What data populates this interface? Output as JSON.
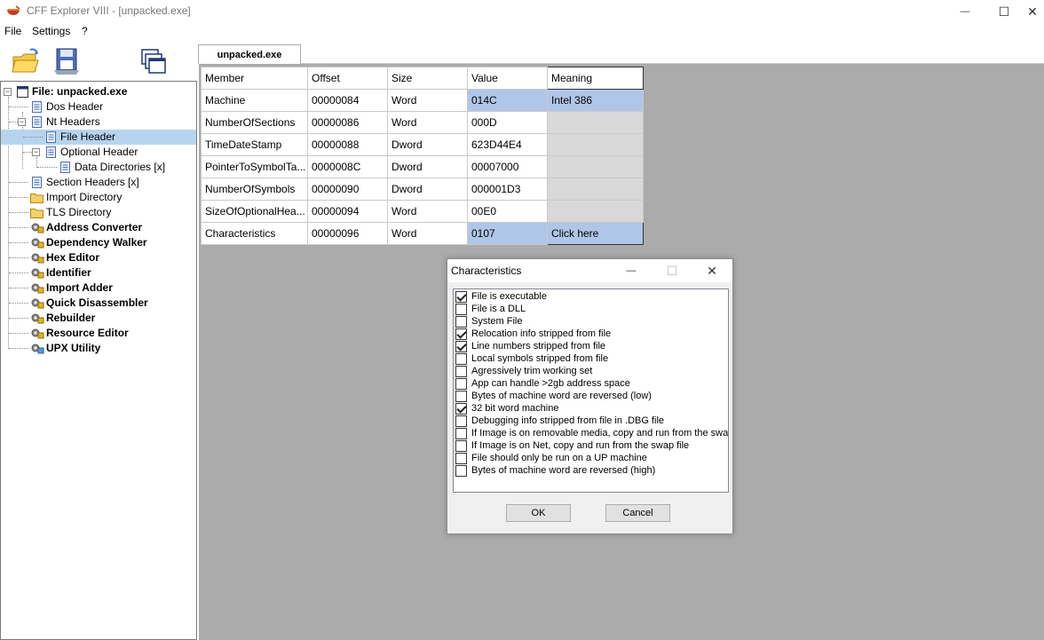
{
  "window": {
    "title": "CFF Explorer VIII - [unpacked.exe]",
    "minimize": "—",
    "maximize": "☐",
    "close": "✕"
  },
  "menu": [
    "File",
    "Settings",
    "?"
  ],
  "toolbar": {
    "icons": [
      "open-folder-icon",
      "save-disk-icon",
      "windows-icon"
    ]
  },
  "tree": {
    "root": "File: unpacked.exe",
    "items": [
      {
        "label": "Dos Header",
        "icon": "header-icon"
      },
      {
        "label": "Nt Headers",
        "icon": "header-icon"
      },
      {
        "label": "File Header",
        "icon": "header-icon",
        "selected": true
      },
      {
        "label": "Optional Header",
        "icon": "header-icon"
      },
      {
        "label": "Data Directories [x]",
        "icon": "header-icon"
      },
      {
        "label": "Section Headers [x]",
        "icon": "header-icon"
      },
      {
        "label": "Import Directory",
        "icon": "folder-icon"
      },
      {
        "label": "TLS Directory",
        "icon": "folder-icon"
      },
      {
        "label": "Address Converter",
        "icon": "tool-icon"
      },
      {
        "label": "Dependency Walker",
        "icon": "tool-icon"
      },
      {
        "label": "Hex Editor",
        "icon": "tool-icon"
      },
      {
        "label": "Identifier",
        "icon": "tool-icon"
      },
      {
        "label": "Import Adder",
        "icon": "tool-icon"
      },
      {
        "label": "Quick Disassembler",
        "icon": "tool-icon"
      },
      {
        "label": "Rebuilder",
        "icon": "tool-icon"
      },
      {
        "label": "Resource Editor",
        "icon": "tool-icon"
      },
      {
        "label": "UPX Utility",
        "icon": "tool-icon"
      }
    ]
  },
  "tab": {
    "label": "unpacked.exe"
  },
  "table": {
    "headers": [
      "Member",
      "Offset",
      "Size",
      "Value",
      "Meaning"
    ],
    "rows": [
      [
        "Machine",
        "00000084",
        "Word",
        "014C",
        "Intel 386"
      ],
      [
        "NumberOfSections",
        "00000086",
        "Word",
        "000D",
        ""
      ],
      [
        "TimeDateStamp",
        "00000088",
        "Dword",
        "623D44E4",
        ""
      ],
      [
        "PointerToSymbolTa...",
        "0000008C",
        "Dword",
        "00007000",
        ""
      ],
      [
        "NumberOfSymbols",
        "00000090",
        "Dword",
        "000001D3",
        ""
      ],
      [
        "SizeOfOptionalHea...",
        "00000094",
        "Word",
        "00E0",
        ""
      ],
      [
        "Characteristics",
        "00000096",
        "Word",
        "0107",
        "Click here"
      ]
    ]
  },
  "dialog": {
    "title": "Characteristics",
    "minimize": "—",
    "maximize": "☐",
    "close": "✕",
    "options": [
      {
        "label": "File is executable",
        "checked": true
      },
      {
        "label": "File is a DLL",
        "checked": false
      },
      {
        "label": "System File",
        "checked": false
      },
      {
        "label": "Relocation info stripped from file",
        "checked": true
      },
      {
        "label": "Line numbers stripped from file",
        "checked": true
      },
      {
        "label": "Local symbols stripped from file",
        "checked": false
      },
      {
        "label": "Agressively trim working set",
        "checked": false
      },
      {
        "label": "App can handle >2gb address space",
        "checked": false
      },
      {
        "label": "Bytes of machine word are reversed (low)",
        "checked": false
      },
      {
        "label": "32 bit word machine",
        "checked": true
      },
      {
        "label": "Debugging info stripped from file in .DBG file",
        "checked": false
      },
      {
        "label": "If Image is on removable media, copy and run from the swap file",
        "checked": false
      },
      {
        "label": "If Image is on Net, copy and run from the swap file",
        "checked": false
      },
      {
        "label": "File should only be run on a UP machine",
        "checked": false
      },
      {
        "label": "Bytes of machine word are reversed (high)",
        "checked": false
      }
    ],
    "ok": "OK",
    "cancel": "Cancel"
  }
}
